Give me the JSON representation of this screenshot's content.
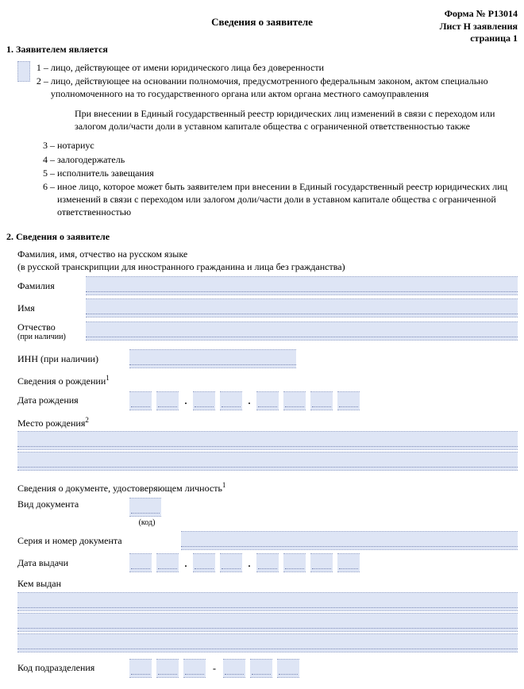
{
  "header": {
    "form_no": "Форма № Р13014",
    "sheet": "Лист Н заявления",
    "page": "страница 1"
  },
  "title": "Сведения о заявителе",
  "s1": {
    "heading": "1. Заявителем является",
    "opt1_num": "1 –",
    "opt1_txt": "лицо, действующее от имени юридического лица без доверенности",
    "opt2_num": "2 –",
    "opt2_txt": "лицо, действующее на основании полномочия, предусмотренного федеральным законом, актом специально уполномоченного на то государственного органа или актом органа местного самоуправления",
    "note": "При внесении в Единый государственный реестр юридических лиц изменений в связи с переходом или залогом доли/части доли в уставном капитале общества с ограниченной ответственностью также",
    "opt3_num": "3 –",
    "opt3_txt": "нотариус",
    "opt4_num": "4 –",
    "opt4_txt": "залогодержатель",
    "opt5_num": "5 –",
    "opt5_txt": "исполнитель завещания",
    "opt6_num": "6 –",
    "opt6_txt": "иное лицо, которое может быть заявителем при внесении в Единый государственный реестр юридических лиц изменений в связи с переходом или залогом доли/части доли в уставном капитале общества с ограниченной ответственностью"
  },
  "s2": {
    "heading": "2. Сведения о заявителе",
    "fio_lbl": "Фамилия, имя, отчество на русском языке",
    "fio_sub": "(в русской транскрипции для иностранного гражданина и лица без гражданства)",
    "fam": "Фамилия",
    "im": "Имя",
    "ot": "Отчество",
    "ot_note": "(при наличии)",
    "inn": "ИНН (при наличии)",
    "birth_h": "Сведения о рождении",
    "dob": "Дата рождения",
    "pob": "Место рождения",
    "doc_h": "Сведения о документе, удостоверяющем личность",
    "doc_type": "Вид документа",
    "code": "(код)",
    "doc_sn": "Серия и номер документа",
    "doc_date": "Дата выдачи",
    "doc_by": "Кем выдан",
    "dep": "Код подразделения",
    "dash": "-",
    "dot": "."
  }
}
